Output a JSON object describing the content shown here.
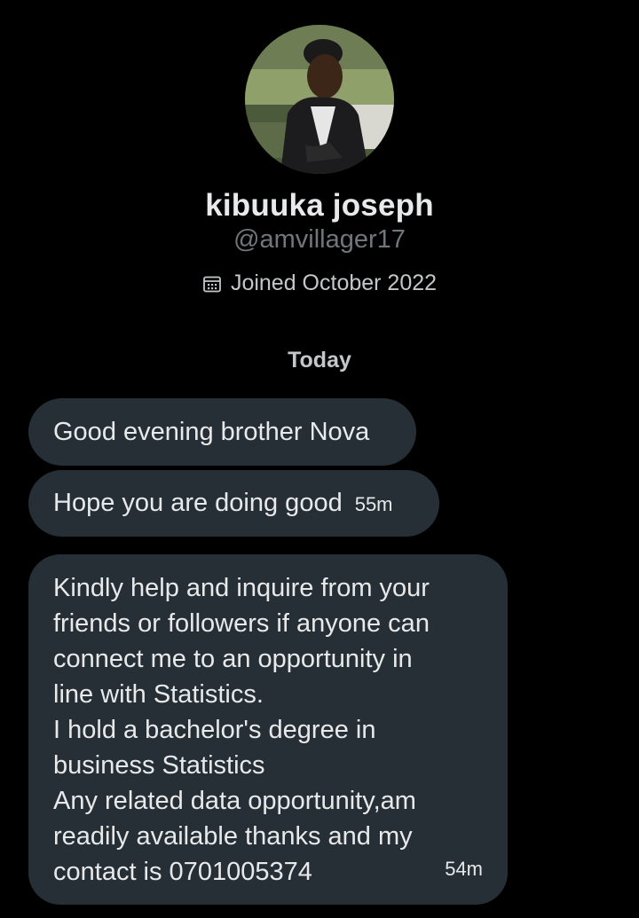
{
  "profile": {
    "avatar_label": "profile-photo",
    "name": "kibuuka joseph",
    "handle": "@amvillager17",
    "joined": "Joined October 2022",
    "joined_icon": "calendar-icon"
  },
  "conversation": {
    "date_separator": "Today",
    "messages": [
      {
        "text": "Good evening brother Nova",
        "time": ""
      },
      {
        "text": "Hope you are doing good",
        "time": "55m"
      },
      {
        "text": "Kindly help and inquire from your\nfriends or followers if anyone can\nconnect me to an opportunity in\nline with Statistics.\nI hold a bachelor's degree in\nbusiness Statistics\nAny related data opportunity,am\nreadily available thanks and my\ncontact is 0701005374",
        "time": "54m"
      }
    ]
  },
  "colors": {
    "background": "#000000",
    "bubble": "#272f36",
    "primary_text": "#e7e9ea",
    "secondary_text": "#71767b"
  }
}
